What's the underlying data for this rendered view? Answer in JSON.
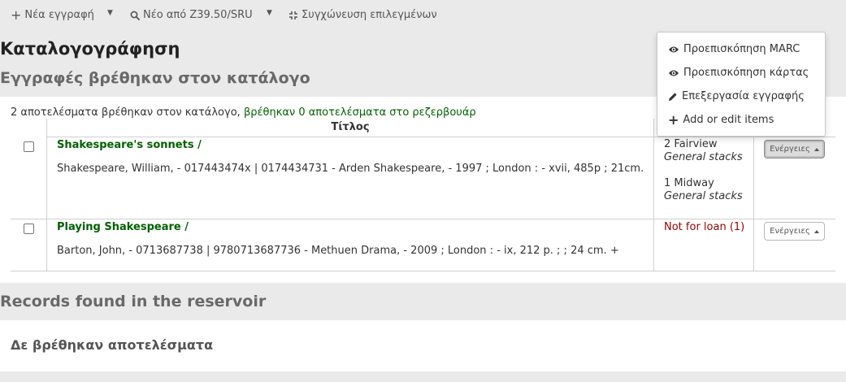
{
  "toolbar": {
    "new_record": "Νέα εγγραφή",
    "new_from_z3950": "Νέο από Z39.50/SRU",
    "merge_selected": "Συγχώνευση επιλεγμένων"
  },
  "page_title": "Καταλογογράφηση",
  "catalog_section": {
    "title": "Εγγραφές βρέθηκαν στον κατάλογο",
    "summary_prefix": "2 αποτελέσματα βρέθηκαν στον κατάλογο,",
    "summary_link": "βρέθηκαν 0 αποτελέσματα στο ρεζερβουάρ",
    "column_title": "Τίτλος",
    "results": [
      {
        "title": "Shakespeare's sonnets /",
        "details": "Shakespeare, William, - 017443474x | 0174434731 - Arden Shakespeare, - 1997 ; London : - xvii, 485p ; 21cm.",
        "holdings": [
          {
            "count_branch": "2 Fairview",
            "location": "General stacks"
          },
          {
            "count_branch": "1 Midway",
            "location": "General stacks"
          }
        ],
        "actions_label": "Ενέργειες"
      },
      {
        "title": "Playing Shakespeare /",
        "details": "Barton, John, - 0713687738 | 9780713687736 - Methuen Drama, - 2009 ; London : - ix, 212 p. ; ; 24 cm. +",
        "availability": "Not for loan (1)",
        "actions_label": "Ενέργειες"
      }
    ]
  },
  "actions_menu": {
    "items": [
      {
        "label": "Προεπισκόπηση MARC",
        "icon": "eye-icon"
      },
      {
        "label": "Προεπισκόπηση κάρτας",
        "icon": "eye-icon"
      },
      {
        "label": "Επεξεργασία εγγραφής",
        "icon": "pencil-icon"
      },
      {
        "label": "Add or edit items",
        "icon": "plus-icon"
      }
    ]
  },
  "reservoir_section": {
    "title": "Records found in the reservoir",
    "no_results": "Δε βρέθηκαν αποτελέσματα"
  },
  "colors": {
    "link_green": "#006100",
    "not_for_loan_red": "#990000",
    "background": "#eaeaea"
  }
}
